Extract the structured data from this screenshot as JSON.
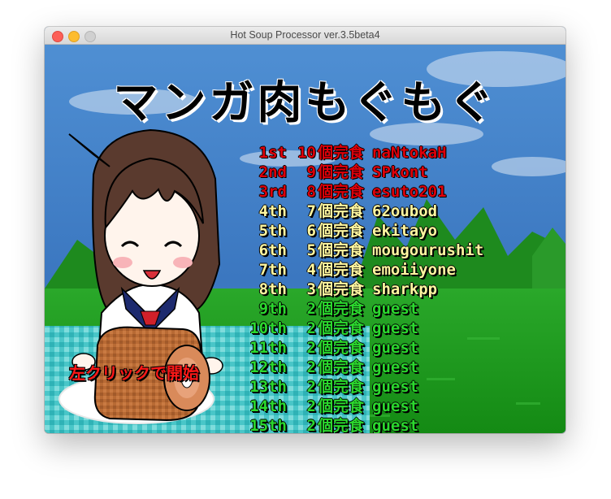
{
  "window": {
    "title": "Hot Soup Processor ver.3.5beta4"
  },
  "game": {
    "title": "マンガ肉もぐもぐ",
    "start_prompt": "左クリックで開始",
    "ranking": [
      {
        "rank": "1st",
        "count": "10",
        "suffix": "個完食",
        "name": "naNtokaH",
        "tier": "top3"
      },
      {
        "rank": "2nd",
        "count": "9",
        "suffix": "個完食",
        "name": "SPkont",
        "tier": "top3"
      },
      {
        "rank": "3rd",
        "count": "8",
        "suffix": "個完食",
        "name": "esuto201",
        "tier": "top3"
      },
      {
        "rank": "4th",
        "count": "7",
        "suffix": "個完食",
        "name": "62oubod",
        "tier": "mid"
      },
      {
        "rank": "5th",
        "count": "6",
        "suffix": "個完食",
        "name": "ekitayo",
        "tier": "mid"
      },
      {
        "rank": "6th",
        "count": "5",
        "suffix": "個完食",
        "name": "mougourushit",
        "tier": "mid"
      },
      {
        "rank": "7th",
        "count": "4",
        "suffix": "個完食",
        "name": "emoiiyone",
        "tier": "mid"
      },
      {
        "rank": "8th",
        "count": "3",
        "suffix": "個完食",
        "name": "sharkpp",
        "tier": "mid"
      },
      {
        "rank": "9th",
        "count": "2",
        "suffix": "個完食",
        "name": "guest",
        "tier": "low"
      },
      {
        "rank": "10th",
        "count": "2",
        "suffix": "個完食",
        "name": "guest",
        "tier": "low"
      },
      {
        "rank": "11th",
        "count": "2",
        "suffix": "個完食",
        "name": "guest",
        "tier": "low"
      },
      {
        "rank": "12th",
        "count": "2",
        "suffix": "個完食",
        "name": "guest",
        "tier": "low"
      },
      {
        "rank": "13th",
        "count": "2",
        "suffix": "個完食",
        "name": "guest",
        "tier": "low"
      },
      {
        "rank": "14th",
        "count": "2",
        "suffix": "個完食",
        "name": "guest",
        "tier": "low"
      },
      {
        "rank": "15th",
        "count": "2",
        "suffix": "個完食",
        "name": "guest",
        "tier": "low"
      }
    ]
  },
  "colors": {
    "sky": "#3d7fc5",
    "grass": "#1f9e1f",
    "rank_top3": "#e0000a",
    "rank_mid": "#fff7a0",
    "rank_low": "#2bd92e",
    "start_prompt": "#ff1818"
  }
}
